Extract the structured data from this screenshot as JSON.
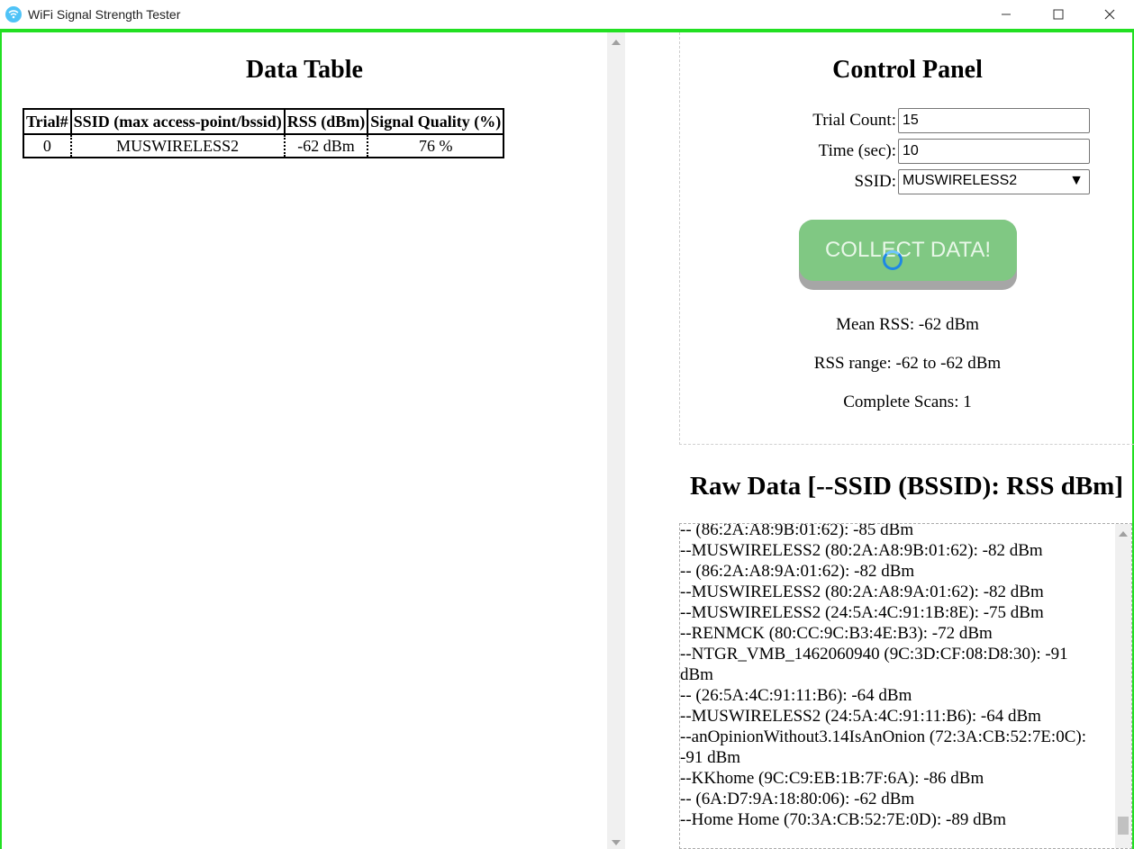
{
  "window": {
    "title": "WiFi Signal Strength Tester",
    "accent_color": "#22e022"
  },
  "data_table": {
    "title": "Data Table",
    "headers": [
      "Trial#",
      "SSID (max access-point/bssid)",
      "RSS (dBm)",
      "Signal Quality (%)"
    ],
    "rows": [
      [
        "0",
        "MUSWIRELESS2",
        "-62 dBm",
        "76 %"
      ]
    ]
  },
  "control_panel": {
    "title": "Control Panel",
    "trial_count_label": "Trial Count:",
    "trial_count_value": "15",
    "time_label": "Time (sec):",
    "time_value": "10",
    "ssid_label": "SSID:",
    "ssid_value": "MUSWIRELESS2",
    "collect_button_label": "COLLECT DATA!",
    "collect_button_color": "#80c883",
    "mean_rss": "Mean RSS: -62 dBm",
    "rss_range": "RSS range: -62 to -62 dBm",
    "complete_scans": "Complete Scans: 1"
  },
  "raw_data": {
    "title": "Raw Data [--SSID (BSSID): RSS dBm]",
    "lines": [
      "-- (86:2A:A8:9B:01:62): -85 dBm",
      "--MUSWIRELESS2 (80:2A:A8:9B:01:62): -82 dBm",
      "-- (86:2A:A8:9A:01:62): -82 dBm",
      "--MUSWIRELESS2 (80:2A:A8:9A:01:62): -82 dBm",
      "--MUSWIRELESS2 (24:5A:4C:91:1B:8E): -75 dBm",
      "--RENMCK (80:CC:9C:B3:4E:B3): -72 dBm",
      "--NTGR_VMB_1462060940 (9C:3D:CF:08:D8:30): -91",
      "dBm",
      "-- (26:5A:4C:91:11:B6): -64 dBm",
      "--MUSWIRELESS2 (24:5A:4C:91:11:B6): -64 dBm",
      "--anOpinionWithout3.14IsAnOnion (72:3A:CB:52:7E:0C):",
      "-91 dBm",
      "--KKhome (9C:C9:EB:1B:7F:6A): -86 dBm",
      "-- (6A:D7:9A:18:80:06): -62 dBm",
      "--Home Home (70:3A:CB:52:7E:0D): -89 dBm"
    ]
  }
}
